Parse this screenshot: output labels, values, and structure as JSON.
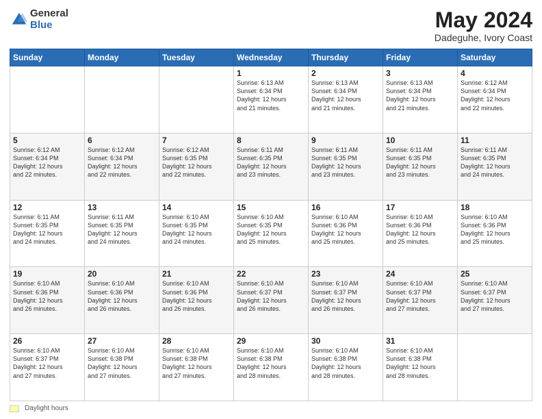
{
  "header": {
    "logo_general": "General",
    "logo_blue": "Blue",
    "title": "May 2024",
    "location": "Dadeguhe, Ivory Coast"
  },
  "footer": {
    "swatch_label": "Daylight hours"
  },
  "days_of_week": [
    "Sunday",
    "Monday",
    "Tuesday",
    "Wednesday",
    "Thursday",
    "Friday",
    "Saturday"
  ],
  "weeks": [
    [
      {
        "day": "",
        "info": ""
      },
      {
        "day": "",
        "info": ""
      },
      {
        "day": "",
        "info": ""
      },
      {
        "day": "1",
        "info": "Sunrise: 6:13 AM\nSunset: 6:34 PM\nDaylight: 12 hours\nand 21 minutes."
      },
      {
        "day": "2",
        "info": "Sunrise: 6:13 AM\nSunset: 6:34 PM\nDaylight: 12 hours\nand 21 minutes."
      },
      {
        "day": "3",
        "info": "Sunrise: 6:13 AM\nSunset: 6:34 PM\nDaylight: 12 hours\nand 21 minutes."
      },
      {
        "day": "4",
        "info": "Sunrise: 6:12 AM\nSunset: 6:34 PM\nDaylight: 12 hours\nand 22 minutes."
      }
    ],
    [
      {
        "day": "5",
        "info": "Sunrise: 6:12 AM\nSunset: 6:34 PM\nDaylight: 12 hours\nand 22 minutes."
      },
      {
        "day": "6",
        "info": "Sunrise: 6:12 AM\nSunset: 6:34 PM\nDaylight: 12 hours\nand 22 minutes."
      },
      {
        "day": "7",
        "info": "Sunrise: 6:12 AM\nSunset: 6:35 PM\nDaylight: 12 hours\nand 22 minutes."
      },
      {
        "day": "8",
        "info": "Sunrise: 6:11 AM\nSunset: 6:35 PM\nDaylight: 12 hours\nand 23 minutes."
      },
      {
        "day": "9",
        "info": "Sunrise: 6:11 AM\nSunset: 6:35 PM\nDaylight: 12 hours\nand 23 minutes."
      },
      {
        "day": "10",
        "info": "Sunrise: 6:11 AM\nSunset: 6:35 PM\nDaylight: 12 hours\nand 23 minutes."
      },
      {
        "day": "11",
        "info": "Sunrise: 6:11 AM\nSunset: 6:35 PM\nDaylight: 12 hours\nand 24 minutes."
      }
    ],
    [
      {
        "day": "12",
        "info": "Sunrise: 6:11 AM\nSunset: 6:35 PM\nDaylight: 12 hours\nand 24 minutes."
      },
      {
        "day": "13",
        "info": "Sunrise: 6:11 AM\nSunset: 6:35 PM\nDaylight: 12 hours\nand 24 minutes."
      },
      {
        "day": "14",
        "info": "Sunrise: 6:10 AM\nSunset: 6:35 PM\nDaylight: 12 hours\nand 24 minutes."
      },
      {
        "day": "15",
        "info": "Sunrise: 6:10 AM\nSunset: 6:35 PM\nDaylight: 12 hours\nand 25 minutes."
      },
      {
        "day": "16",
        "info": "Sunrise: 6:10 AM\nSunset: 6:36 PM\nDaylight: 12 hours\nand 25 minutes."
      },
      {
        "day": "17",
        "info": "Sunrise: 6:10 AM\nSunset: 6:36 PM\nDaylight: 12 hours\nand 25 minutes."
      },
      {
        "day": "18",
        "info": "Sunrise: 6:10 AM\nSunset: 6:36 PM\nDaylight: 12 hours\nand 25 minutes."
      }
    ],
    [
      {
        "day": "19",
        "info": "Sunrise: 6:10 AM\nSunset: 6:36 PM\nDaylight: 12 hours\nand 26 minutes."
      },
      {
        "day": "20",
        "info": "Sunrise: 6:10 AM\nSunset: 6:36 PM\nDaylight: 12 hours\nand 26 minutes."
      },
      {
        "day": "21",
        "info": "Sunrise: 6:10 AM\nSunset: 6:36 PM\nDaylight: 12 hours\nand 26 minutes."
      },
      {
        "day": "22",
        "info": "Sunrise: 6:10 AM\nSunset: 6:37 PM\nDaylight: 12 hours\nand 26 minutes."
      },
      {
        "day": "23",
        "info": "Sunrise: 6:10 AM\nSunset: 6:37 PM\nDaylight: 12 hours\nand 26 minutes."
      },
      {
        "day": "24",
        "info": "Sunrise: 6:10 AM\nSunset: 6:37 PM\nDaylight: 12 hours\nand 27 minutes."
      },
      {
        "day": "25",
        "info": "Sunrise: 6:10 AM\nSunset: 6:37 PM\nDaylight: 12 hours\nand 27 minutes."
      }
    ],
    [
      {
        "day": "26",
        "info": "Sunrise: 6:10 AM\nSunset: 6:37 PM\nDaylight: 12 hours\nand 27 minutes."
      },
      {
        "day": "27",
        "info": "Sunrise: 6:10 AM\nSunset: 6:38 PM\nDaylight: 12 hours\nand 27 minutes."
      },
      {
        "day": "28",
        "info": "Sunrise: 6:10 AM\nSunset: 6:38 PM\nDaylight: 12 hours\nand 27 minutes."
      },
      {
        "day": "29",
        "info": "Sunrise: 6:10 AM\nSunset: 6:38 PM\nDaylight: 12 hours\nand 28 minutes."
      },
      {
        "day": "30",
        "info": "Sunrise: 6:10 AM\nSunset: 6:38 PM\nDaylight: 12 hours\nand 28 minutes."
      },
      {
        "day": "31",
        "info": "Sunrise: 6:10 AM\nSunset: 6:38 PM\nDaylight: 12 hours\nand 28 minutes."
      },
      {
        "day": "",
        "info": ""
      }
    ]
  ]
}
